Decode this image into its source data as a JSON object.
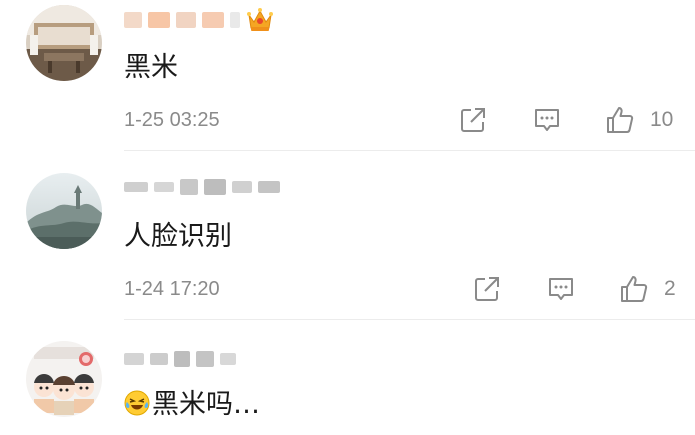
{
  "comments": [
    {
      "avatar_icon": "avatar-room-interior-icon",
      "username_badge_icon": "crown-badge-icon",
      "text": "黑米",
      "timestamp": "1-25 03:25",
      "like_count": "10"
    },
    {
      "avatar_icon": "avatar-misty-mountain-icon",
      "text": "人脸识别",
      "timestamp": "1-24 17:20",
      "like_count": "2"
    },
    {
      "avatar_icon": "avatar-cartoon-characters-icon",
      "text_emoji_icon": "laughing-crying-emoji-icon",
      "text": "黑米吗…"
    }
  ],
  "action_icons": [
    "share-icon",
    "reply-icon",
    "like-icon"
  ],
  "colors": {
    "meta_text": "#8a8a8a",
    "primary_text": "#1a1a1a",
    "divider": "#ececec",
    "crown_gold": "#f5a623"
  }
}
